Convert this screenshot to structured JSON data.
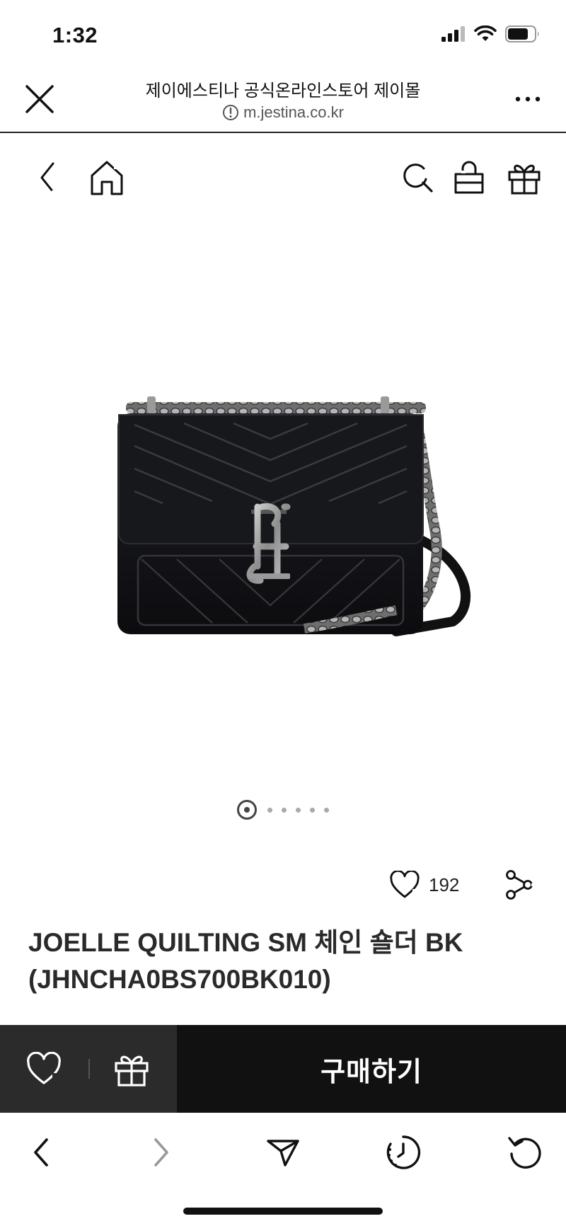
{
  "status_bar": {
    "time": "1:32"
  },
  "browser_header": {
    "site_title": "제이에스티나 공식온라인스토어 제이몰",
    "url": "m.jestina.co.kr"
  },
  "product": {
    "like_count": "192",
    "name_line1": "JOELLE QUILTING SM 체인 숄더 BK",
    "name_line2": "(JHNCHA0BS700BK010)",
    "image_count": 6,
    "active_image": 1
  },
  "buy_bar": {
    "buy_label": "구매하기"
  },
  "icons": {
    "close": "close-icon",
    "more": "more-icon",
    "back": "chevron-left-icon",
    "home": "home-icon",
    "search": "search-icon",
    "cart": "shopping-bag-icon",
    "gift": "gift-icon",
    "heart": "heart-icon",
    "share": "share-icon",
    "send": "send-icon",
    "history": "history-icon",
    "reload": "reload-icon"
  }
}
